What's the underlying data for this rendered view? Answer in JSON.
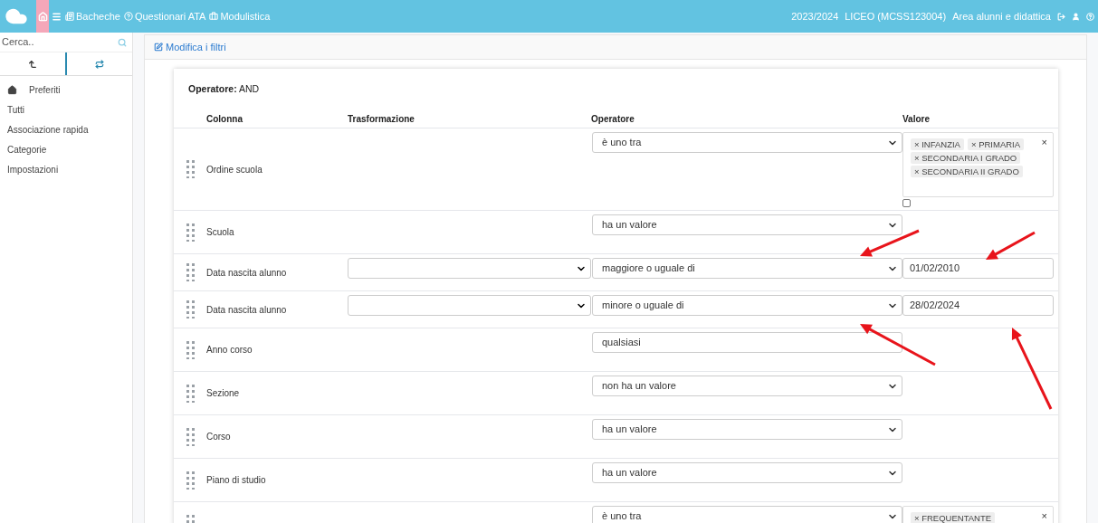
{
  "topbar": {
    "nav": [
      {
        "label": "Bacheche"
      },
      {
        "label": "Questionari ATA"
      },
      {
        "label": "Modulistica"
      }
    ],
    "year": "2023/2024",
    "school": "LICEO (MCSS123004)",
    "area": "Area alunni e didattica"
  },
  "sidebar": {
    "search": {
      "placeholder": "Cerca.."
    },
    "tabs": [
      {
        "selected": false
      },
      {
        "selected": true
      }
    ],
    "items": [
      {
        "label": "Preferiti",
        "icon": true
      },
      {
        "label": "Tutti",
        "icon": false
      },
      {
        "label": "Associazione rapida",
        "icon": false
      },
      {
        "label": "Categorie",
        "icon": false
      },
      {
        "label": "Impostazioni",
        "icon": false
      }
    ]
  },
  "panel": {
    "header": "Modifica i filtri",
    "operator_label": "Operatore:",
    "operator_value": "AND",
    "columns": [
      "Colonna",
      "Trasformazione",
      "Operatore",
      "Valore"
    ],
    "rows": [
      {
        "column": "Ordine scuola",
        "transform": false,
        "operator": "è uno tra",
        "dropdown": true,
        "value": {
          "kind": "tags",
          "tags": [
            "INFANZIA",
            "PRIMARIA",
            "SECONDARIA I GRADO",
            "SECONDARIA II GRADO"
          ],
          "tag_remove": "×",
          "clear": "×",
          "checkbox": {
            "checked": false
          }
        }
      },
      {
        "column": "Scuola",
        "transform": false,
        "operator": "ha un valore",
        "dropdown": true
      },
      {
        "column": "Data nascita alunno",
        "transform": true,
        "operator": "maggiore o uguale di",
        "dropdown": true,
        "value": {
          "kind": "text",
          "text": "01/02/2010"
        }
      },
      {
        "column": "Data nascita alunno",
        "transform": true,
        "operator": "minore o uguale di",
        "dropdown": true,
        "value": {
          "kind": "text",
          "text": "28/02/2024"
        }
      },
      {
        "column": "Anno corso",
        "transform": false,
        "operator": "qualsiasi",
        "dropdown": false
      },
      {
        "column": "Sezione",
        "transform": false,
        "operator": "non ha un valore",
        "dropdown": true
      },
      {
        "column": "Corso",
        "transform": false,
        "operator": "ha un valore",
        "dropdown": true
      },
      {
        "column": "Piano di studio",
        "transform": false,
        "operator": "ha un valore",
        "dropdown": true
      },
      {
        "transform": false,
        "operator": "è uno tra",
        "dropdown": true,
        "value": {
          "kind": "tags",
          "tags": [
            "FREQUENTANTE"
          ],
          "tag_remove": "×",
          "clear": "×"
        }
      }
    ]
  }
}
